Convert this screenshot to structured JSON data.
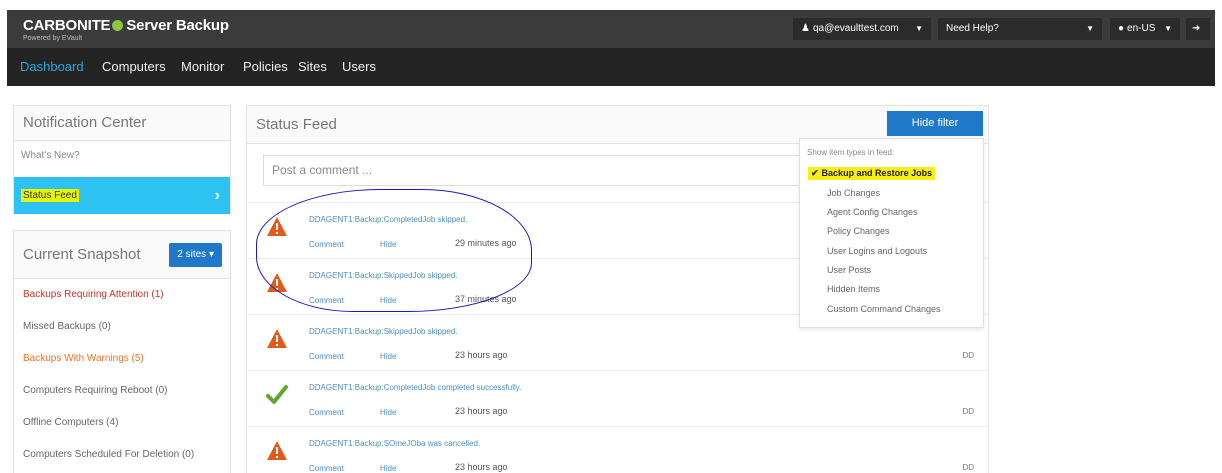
{
  "header": {
    "brand": "CARBONITE",
    "brand_product": "Server Backup",
    "brand_sub": "Powered by EVault",
    "user_menu": "qa@evaulttest.com",
    "help_menu": "Need Help?",
    "locale_menu": "en-US"
  },
  "nav": [
    "Dashboard",
    "Computers",
    "Monitor",
    "Policies",
    "Sites",
    "Users"
  ],
  "notification_center": {
    "title": "Notification Center",
    "items": [
      "What's New?",
      "Status Feed"
    ]
  },
  "snapshot": {
    "title": "Current Snapshot",
    "sites_button": "2 sites",
    "items": [
      "Backups Requiring Attention (1)",
      "Missed Backups (0)",
      "Backups With Warnings (5)",
      "Computers Requiring Reboot (0)",
      "Offline Computers (4)",
      "Computers Scheduled For Deletion (0)"
    ]
  },
  "feed": {
    "title": "Status Feed",
    "hide_filter": "Hide filter",
    "comment_placeholder": "Post a comment ...",
    "comment_label": "Comment",
    "hide_label": "Hide",
    "rows": [
      {
        "status": "warning",
        "title": "DDAGENT1:Backup:CompletedJob skipped.",
        "time": "29 minutes ago",
        "initials": ""
      },
      {
        "status": "warning",
        "title": "DDAGENT1:Backup:SkippedJob skipped.",
        "time": "37 minutes ago",
        "initials": ""
      },
      {
        "status": "warning",
        "title": "DDAGENT1:Backup:SkippedJob skipped.",
        "time": "23 hours ago",
        "initials": "DD"
      },
      {
        "status": "success",
        "title": "DDAGENT1:Backup:CompletedJob completed successfully.",
        "time": "23 hours ago",
        "initials": "DD"
      },
      {
        "status": "warning",
        "title": "DDAGENT1:Backup:SOmeJOba was cancelled.",
        "time": "23 hours ago",
        "initials": "DD"
      }
    ]
  },
  "filter": {
    "heading": "Show item types in feed:",
    "items": [
      "Backup and Restore Jobs",
      "Job Changes",
      "Agent Config Changes",
      "Policy Changes",
      "User Logins and Logouts",
      "User Posts",
      "Hidden Items",
      "Custom Command Changes"
    ]
  },
  "colors": {
    "accent": "#2aa7e0",
    "selected_row": "#2ec2f2",
    "button": "#1f78c8",
    "warning": "#e25b1b",
    "success": "#5ea82b",
    "highlight": "#f6ee15",
    "annotation": "#1b1bb7"
  }
}
